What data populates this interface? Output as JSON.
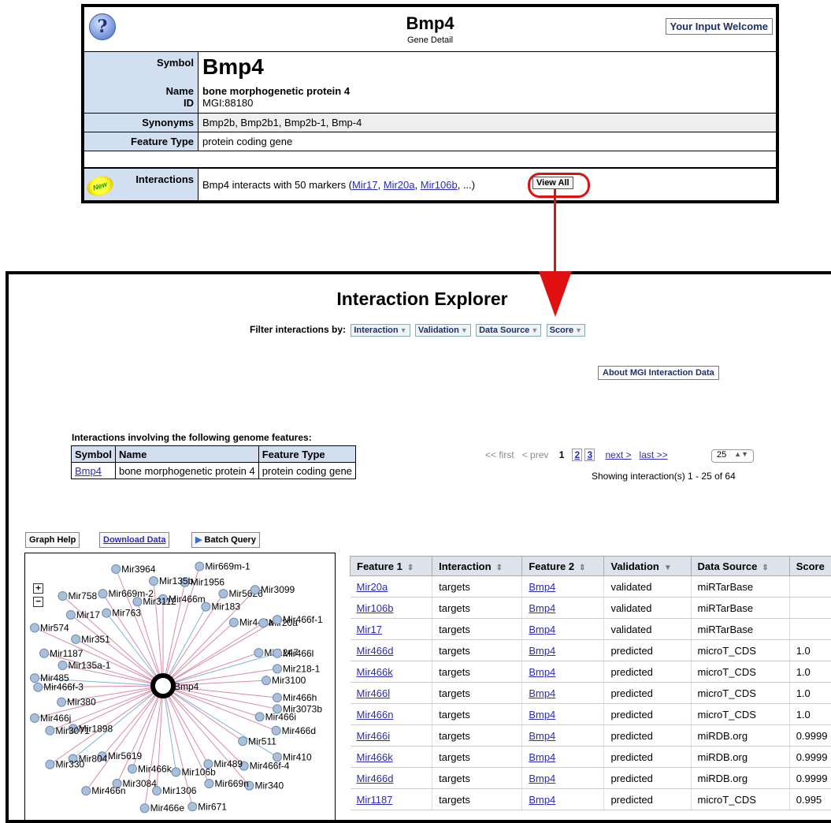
{
  "gene": {
    "help_icon": "?",
    "title": "Bmp4",
    "subtitle": "Gene Detail",
    "input_welcome": "Your Input Welcome",
    "symbol_label": "Symbol",
    "symbol": "Bmp4",
    "name_label": "Name",
    "name": "bone morphogenetic protein 4",
    "id_label": "ID",
    "id": "MGI:88180",
    "synonyms_label": "Synonyms",
    "synonyms": "Bmp2b, Bmp2b1, Bmp2b-1, Bmp-4",
    "feature_type_label": "Feature Type",
    "feature_type": "protein coding gene",
    "new_badge": "New",
    "interactions_label": "Interactions",
    "interactions_text": "Bmp4 interacts with 50 markers (",
    "interaction_links": [
      "Mir17",
      "Mir20a",
      "Mir106b"
    ],
    "interactions_more": ", ...)",
    "view_all": "View All"
  },
  "explorer": {
    "title": "Interaction Explorer",
    "filter_label": "Filter interactions by:",
    "filters": [
      "Interaction",
      "Validation",
      "Data Source",
      "Score"
    ],
    "about": "About MGI Interaction Data",
    "genome_caption": "Interactions involving the following genome features:",
    "genome_headers": [
      "Symbol",
      "Name",
      "Feature Type"
    ],
    "genome_row": [
      "Bmp4",
      "bone morphogenetic protein 4",
      "protein coding gene"
    ],
    "pager": {
      "first": "<< first",
      "prev": "< prev",
      "pages": [
        "1",
        "2",
        "3"
      ],
      "next": "next >",
      "last": "last >>",
      "per_page": "25",
      "showing": "Showing interaction(s) 1 - 25 of 64"
    },
    "toolbar": {
      "graph_help": "Graph Help",
      "download": "Download Data",
      "batch": "Batch Query"
    },
    "graph": {
      "center": "Bmp4",
      "nodes": [
        "Mir466m",
        "Mir1956",
        "Mir669m-1",
        "Mir183",
        "Mir5626",
        "Mir3099",
        "Mir449a",
        "Mir20a",
        "Mir466f-1",
        "Mir1247",
        "Mir466l",
        "Mir218-1",
        "Mir3100",
        "Mir466h",
        "Mir3073b",
        "Mir466i",
        "Mir466d",
        "Mir410",
        "Mir511",
        "Mir466f-4",
        "Mir340",
        "Mir489",
        "Mir669n",
        "Mir671",
        "Mir106b",
        "Mir1306",
        "Mir466e",
        "Mir466k",
        "Mir3084",
        "Mir466n",
        "Mir5619",
        "Mir804",
        "Mir330",
        "Mir1898",
        "Mir3071",
        "Mir466j",
        "Mir380",
        "Mir466f-3",
        "Mir485",
        "Mir135a-1",
        "Mir1187",
        "Mir574",
        "Mir351",
        "Mir17",
        "Mir758",
        "Mir763",
        "Mir669m-2",
        "Mir3964",
        "Mir3112",
        "Mir135b"
      ]
    },
    "table": {
      "headers": [
        "Feature 1",
        "Interaction",
        "Feature 2",
        "Validation",
        "Data Source",
        "Score"
      ],
      "rows": [
        [
          "Mir20a",
          "targets",
          "Bmp4",
          "validated",
          "miRTarBase",
          ""
        ],
        [
          "Mir106b",
          "targets",
          "Bmp4",
          "validated",
          "miRTarBase",
          ""
        ],
        [
          "Mir17",
          "targets",
          "Bmp4",
          "validated",
          "miRTarBase",
          ""
        ],
        [
          "Mir466d",
          "targets",
          "Bmp4",
          "predicted",
          "microT_CDS",
          "1.0"
        ],
        [
          "Mir466k",
          "targets",
          "Bmp4",
          "predicted",
          "microT_CDS",
          "1.0"
        ],
        [
          "Mir466l",
          "targets",
          "Bmp4",
          "predicted",
          "microT_CDS",
          "1.0"
        ],
        [
          "Mir466n",
          "targets",
          "Bmp4",
          "predicted",
          "microT_CDS",
          "1.0"
        ],
        [
          "Mir466i",
          "targets",
          "Bmp4",
          "predicted",
          "miRDB.org",
          "0.9999"
        ],
        [
          "Mir466k",
          "targets",
          "Bmp4",
          "predicted",
          "miRDB.org",
          "0.9999"
        ],
        [
          "Mir466d",
          "targets",
          "Bmp4",
          "predicted",
          "miRDB.org",
          "0.9999"
        ],
        [
          "Mir1187",
          "targets",
          "Bmp4",
          "predicted",
          "microT_CDS",
          "0.995"
        ]
      ]
    }
  }
}
